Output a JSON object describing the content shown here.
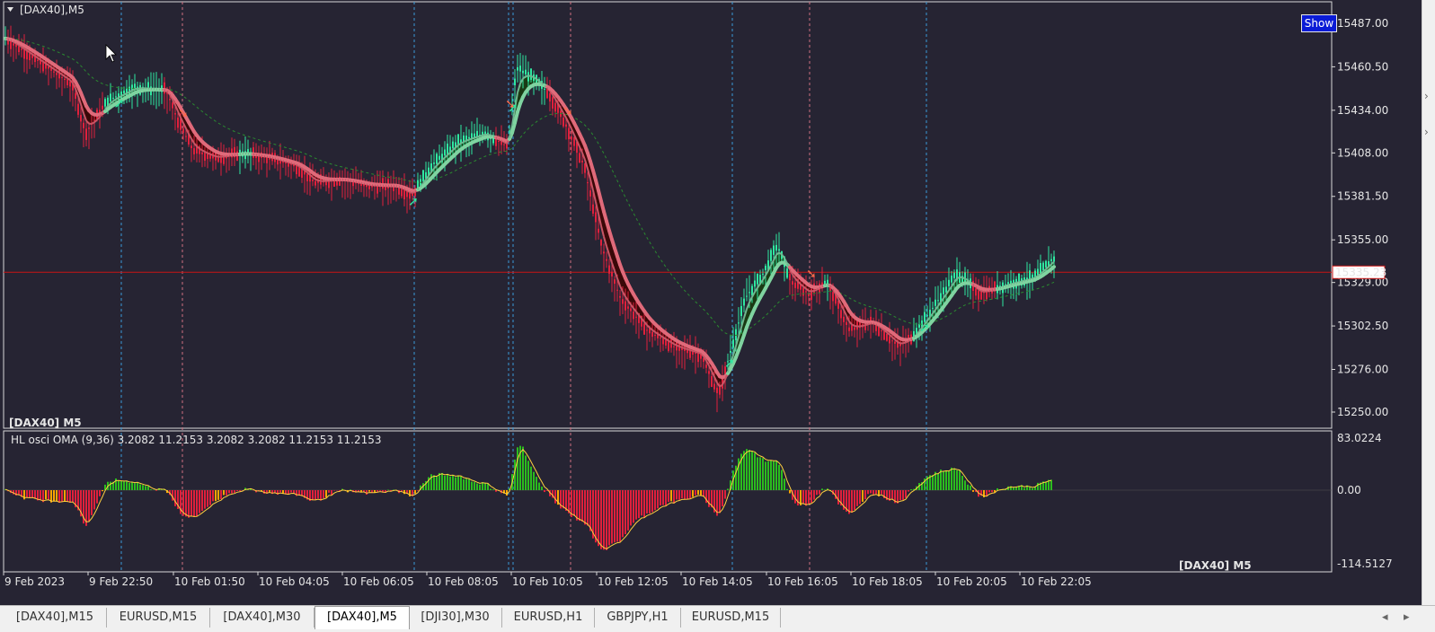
{
  "window": {
    "symbol_label": "[DAX40],M5",
    "watermark": "[DAX40] M5",
    "show_button": "Show"
  },
  "colors": {
    "background": "#262433",
    "bull": "#2fe8a0",
    "bear": "#e0203c",
    "orange": "#ffa500",
    "osc_green": "#2bbd1e",
    "grid_line": "#3a9ad9",
    "pink_line": "#d07080",
    "bid_line": "#c81414"
  },
  "main_panel": {
    "price_ticks": [
      "15487.00",
      "15460.50",
      "15434.00",
      "15408.00",
      "15381.50",
      "15355.00",
      "15329.00",
      "15302.50",
      "15276.00",
      "15250.00"
    ],
    "current_price": "15335.23"
  },
  "oscillator": {
    "title": "HL osci OMA (9,36) 3.2082 11.2153 3.2082 3.2082 11.2153 11.2153",
    "ticks": [
      "83.0224",
      "0.00",
      "-114.5127"
    ]
  },
  "time_axis": [
    "9 Feb 2023",
    "9 Feb 22:50",
    "10 Feb 01:50",
    "10 Feb 04:05",
    "10 Feb 06:05",
    "10 Feb 08:05",
    "10 Feb 10:05",
    "10 Feb 12:05",
    "10 Feb 14:05",
    "10 Feb 16:05",
    "10 Feb 18:05",
    "10 Feb 20:05",
    "10 Feb 22:05"
  ],
  "tabs": [
    {
      "label": "[DAX40],M15",
      "active": false
    },
    {
      "label": "EURUSD,M15",
      "active": false
    },
    {
      "label": "[DAX40],M30",
      "active": false
    },
    {
      "label": "[DAX40],M5",
      "active": true
    },
    {
      "label": "[DJI30],M30",
      "active": false
    },
    {
      "label": "EURUSD,H1",
      "active": false
    },
    {
      "label": "GBPJPY,H1",
      "active": false
    },
    {
      "label": "EURUSD,M15",
      "active": false
    }
  ],
  "chart_data": {
    "type": "line",
    "price_path": [
      [
        0,
        15480
      ],
      [
        40,
        15465
      ],
      [
        80,
        15450
      ],
      [
        95,
        15420
      ],
      [
        120,
        15440
      ],
      [
        150,
        15448
      ],
      [
        185,
        15446
      ],
      [
        200,
        15425
      ],
      [
        215,
        15410
      ],
      [
        240,
        15405
      ],
      [
        270,
        15408
      ],
      [
        300,
        15405
      ],
      [
        330,
        15400
      ],
      [
        350,
        15390
      ],
      [
        380,
        15392
      ],
      [
        410,
        15388
      ],
      [
        440,
        15388
      ],
      [
        458,
        15382
      ],
      [
        480,
        15400
      ],
      [
        510,
        15415
      ],
      [
        540,
        15420
      ],
      [
        565,
        15412
      ],
      [
        575,
        15460
      ],
      [
        590,
        15455
      ],
      [
        610,
        15445
      ],
      [
        630,
        15425
      ],
      [
        650,
        15400
      ],
      [
        670,
        15350
      ],
      [
        690,
        15320
      ],
      [
        720,
        15300
      ],
      [
        750,
        15290
      ],
      [
        780,
        15285
      ],
      [
        800,
        15260
      ],
      [
        812,
        15285
      ],
      [
        830,
        15320
      ],
      [
        850,
        15335
      ],
      [
        865,
        15352
      ],
      [
        880,
        15330
      ],
      [
        900,
        15322
      ],
      [
        920,
        15330
      ],
      [
        945,
        15300
      ],
      [
        970,
        15305
      ],
      [
        1000,
        15290
      ],
      [
        1015,
        15296
      ],
      [
        1040,
        15315
      ],
      [
        1065,
        15335
      ],
      [
        1090,
        15322
      ],
      [
        1120,
        15328
      ],
      [
        1150,
        15332
      ],
      [
        1175,
        15345
      ]
    ]
  }
}
